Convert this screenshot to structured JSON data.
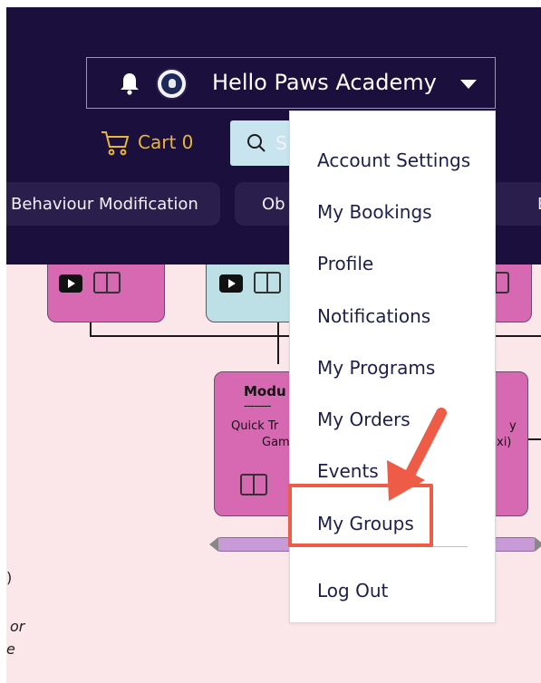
{
  "header": {
    "account_name": "Hello Paws Academy",
    "cart_label": "Cart 0",
    "search_placeholder": "S",
    "categories": [
      {
        "label": "Behaviour Modification"
      },
      {
        "label": "Ob"
      },
      {
        "label": "B"
      }
    ]
  },
  "dropdown": {
    "items": [
      {
        "label": "Account Settings"
      },
      {
        "label": "My Bookings"
      },
      {
        "label": "Profile"
      },
      {
        "label": "Notifications"
      },
      {
        "label": "My Programs"
      },
      {
        "label": "My Orders"
      },
      {
        "label": "Events"
      },
      {
        "label": "My Groups"
      },
      {
        "label": "Log Out"
      }
    ],
    "highlighted_item": "My Groups"
  },
  "background": {
    "module_title": "Modu",
    "module_dashes": "--------",
    "module_line1": "Quick Tr",
    "module_line2": "Gam",
    "right_card_line1": "y",
    "right_card_line2": "xi)",
    "side_text_1": ")",
    "side_text_2": "or",
    "side_text_3": "e"
  },
  "colors": {
    "header_bg": "#1b0f3d",
    "cart_accent": "#e9b635",
    "search_bg": "#c7e4ef",
    "menu_text": "#1c1f4c",
    "highlight": "#ee5b46",
    "card_pink": "#d669b1",
    "card_blue": "#bde0e6",
    "diagram_bg": "#fbe6ea"
  }
}
